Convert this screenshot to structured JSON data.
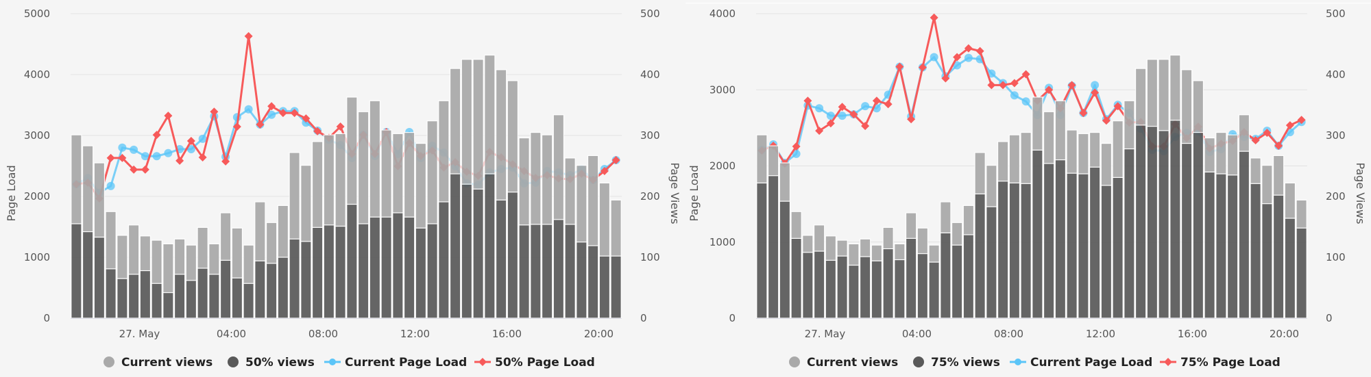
{
  "colors": {
    "current_views": "#a9a9a9",
    "pct_views": "#595959",
    "current_load": "#5bc5f8",
    "pct_load": "#f75a5a",
    "grid": "#e2e2e2"
  },
  "chart_data": [
    {
      "type": "bar+line",
      "title": "",
      "x_tick_labels": [
        "27. May",
        "04:00",
        "08:00",
        "12:00",
        "16:00",
        "20:00"
      ],
      "x_start": "26 May 21:00",
      "x_interval": "30 min",
      "left_axis": {
        "label": "Page Load",
        "ylim": [
          0,
          5000
        ],
        "ticks": [
          "0",
          "1000",
          "2000",
          "3000",
          "4000",
          "5000"
        ]
      },
      "right_axis": {
        "label": "Page Views",
        "ylim": [
          0,
          500
        ],
        "ticks": [
          "0",
          "100",
          "200",
          "300",
          "400",
          "500"
        ]
      },
      "legend_position": "bottom",
      "legend": [
        "Current views",
        "50% views",
        "Current Page Load",
        "50% Page Load"
      ],
      "series": [
        {
          "name": "Current views",
          "type": "bar",
          "axis": "right",
          "values": [
            301,
            283,
            255,
            175,
            136,
            153,
            135,
            128,
            122,
            130,
            120,
            149,
            122,
            173,
            148,
            120,
            191,
            157,
            185,
            272,
            251,
            290,
            301,
            303,
            363,
            339,
            357,
            309,
            303,
            305,
            287,
            324,
            357,
            410,
            425,
            425,
            432,
            408,
            390,
            296,
            305,
            301,
            334,
            263,
            251,
            267,
            222,
            194
          ]
        },
        {
          "name": "50% views",
          "type": "bar",
          "axis": "right",
          "values": [
            155,
            142,
            133,
            81,
            65,
            72,
            78,
            57,
            42,
            72,
            62,
            82,
            72,
            95,
            66,
            57,
            94,
            90,
            100,
            130,
            126,
            149,
            153,
            151,
            187,
            155,
            166,
            166,
            173,
            166,
            148,
            155,
            191,
            237,
            220,
            212,
            237,
            194,
            207,
            153,
            154,
            154,
            162,
            154,
            125,
            119,
            102,
            102
          ]
        },
        {
          "name": "Current Page Load",
          "type": "line",
          "axis": "left",
          "values": [
            2200,
            2300,
            2060,
            2170,
            2800,
            2765,
            2660,
            2660,
            2710,
            2775,
            2775,
            2945,
            3315,
            2650,
            3300,
            3430,
            3180,
            3340,
            3400,
            3400,
            3210,
            3080,
            2930,
            2843,
            2629,
            3011,
            2663,
            3056,
            2697,
            3056,
            2629,
            2831,
            2719,
            2494,
            2213,
            2191,
            2393,
            2449,
            2472,
            2213,
            2225,
            2416,
            2393,
            2348,
            2449,
            2270,
            2449,
            2596
          ]
        },
        {
          "name": "50% Page Load",
          "type": "line",
          "axis": "left",
          "values": [
            2200,
            2225,
            1965,
            2630,
            2630,
            2440,
            2440,
            3010,
            3325,
            2585,
            2910,
            2640,
            3390,
            2575,
            3145,
            4630,
            3180,
            3480,
            3370,
            3370,
            3280,
            3070,
            2960,
            3146,
            2697,
            3011,
            2697,
            3056,
            2494,
            2876,
            2663,
            2753,
            2472,
            2562,
            2404,
            2337,
            2730,
            2640,
            2528,
            2416,
            2303,
            2348,
            2292,
            2281,
            2371,
            2270,
            2416,
            2596
          ]
        }
      ]
    },
    {
      "type": "bar+line",
      "title": "",
      "x_tick_labels": [
        "27. May",
        "04:00",
        "08:00",
        "12:00",
        "16:00",
        "20:00"
      ],
      "x_start": "26 May 21:00",
      "x_interval": "30 min",
      "left_axis": {
        "label": "Page Load",
        "ylim": [
          0,
          4000
        ],
        "ticks": [
          "0",
          "1000",
          "2000",
          "3000",
          "4000"
        ]
      },
      "right_axis": {
        "label": "Page Views",
        "ylim": [
          0,
          500
        ],
        "ticks": [
          "0",
          "100",
          "200",
          "300",
          "400",
          "500"
        ]
      },
      "legend_position": "bottom",
      "legend": [
        "Current views",
        "75% views",
        "Current Page Load",
        "75% Page Load"
      ],
      "series": [
        {
          "name": "Current views",
          "type": "bar",
          "axis": "right",
          "values": [
            301,
            283,
            255,
            175,
            136,
            153,
            135,
            128,
            122,
            130,
            120,
            149,
            122,
            173,
            148,
            120,
            191,
            157,
            185,
            272,
            251,
            290,
            301,
            305,
            363,
            339,
            357,
            309,
            303,
            305,
            287,
            324,
            357,
            410,
            425,
            425,
            432,
            408,
            390,
            296,
            305,
            301,
            334,
            263,
            251,
            267,
            222,
            194
          ]
        },
        {
          "name": "75% views",
          "type": "bar",
          "axis": "right",
          "values": [
            222,
            234,
            192,
            131,
            108,
            110,
            95,
            102,
            87,
            101,
            94,
            114,
            96,
            131,
            106,
            92,
            140,
            120,
            137,
            204,
            183,
            225,
            222,
            221,
            276,
            254,
            260,
            238,
            237,
            248,
            218,
            231,
            278,
            317,
            315,
            308,
            325,
            287,
            305,
            240,
            237,
            235,
            274,
            221,
            188,
            202,
            164,
            148
          ]
        },
        {
          "name": "Current Page Load",
          "type": "line",
          "axis": "left",
          "values": [
            2211,
            2283,
            2041,
            2158,
            2793,
            2757,
            2659,
            2659,
            2677,
            2785,
            2757,
            2936,
            3303,
            2650,
            3294,
            3429,
            3178,
            3321,
            3419,
            3402,
            3214,
            3088,
            2927,
            2847,
            2668,
            3026,
            2668,
            3053,
            2695,
            3062,
            2614,
            2802,
            2695,
            2489,
            2211,
            2193,
            2381,
            2435,
            2453,
            2184,
            2220,
            2417,
            2381,
            2355,
            2462,
            2265,
            2444,
            2578
          ]
        },
        {
          "name": "75% Page Load",
          "type": "line",
          "axis": "left",
          "values": [
            2202,
            2265,
            2032,
            2256,
            2856,
            2462,
            2560,
            2775,
            2677,
            2525,
            2856,
            2811,
            3303,
            2614,
            3294,
            3948,
            3151,
            3429,
            3545,
            3509,
            3062,
            3062,
            3088,
            3205,
            2856,
            2999,
            2757,
            3062,
            2695,
            2963,
            2596,
            2784,
            2569,
            2578,
            2256,
            2256,
            2551,
            2364,
            2516,
            2229,
            2292,
            2328,
            2444,
            2337,
            2435,
            2265,
            2534,
            2605
          ]
        }
      ]
    }
  ]
}
